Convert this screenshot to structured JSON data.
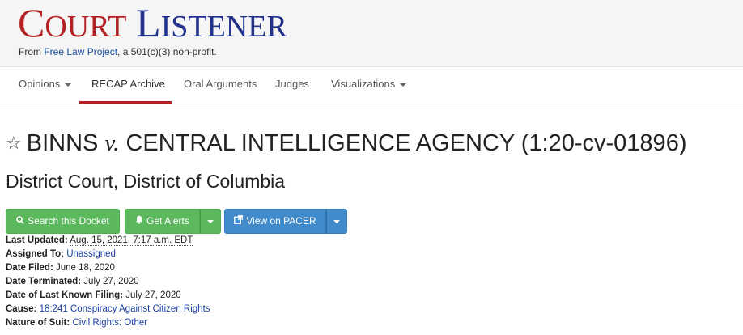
{
  "logo": {
    "court_c": "C",
    "court_rest": "OURT",
    "listener_l": "L",
    "listener_rest": "ISTENER"
  },
  "tagline": {
    "prefix": "From ",
    "link": "Free Law Project",
    "suffix": ", a 501(c)(3) non-profit."
  },
  "nav": {
    "items": [
      {
        "label": "Opinions",
        "has_caret": true
      },
      {
        "label": "RECAP Archive",
        "active": true
      },
      {
        "label": "Oral Arguments"
      },
      {
        "label": "Judges"
      },
      {
        "label": "Visualizations",
        "has_caret": true
      }
    ]
  },
  "case": {
    "title_before": "BINNS ",
    "title_v": "v.",
    "title_after": " CENTRAL INTELLIGENCE AGENCY (1:20-cv-01896)",
    "court": "District Court, District of Columbia"
  },
  "buttons": {
    "search": "Search this Docket",
    "alerts": "Get Alerts",
    "pacer": "View on PACER"
  },
  "meta": {
    "last_updated_label": "Last Updated:",
    "last_updated": "Aug. 15, 2021, 7:17 a.m. EDT",
    "assigned_label": "Assigned To:",
    "assigned": "Unassigned",
    "filed_label": "Date Filed:",
    "filed": "June 18, 2020",
    "terminated_label": "Date Terminated:",
    "terminated": "July 27, 2020",
    "last_filing_label": "Date of Last Known Filing:",
    "last_filing": "July 27, 2020",
    "cause_label": "Cause:",
    "cause": "18:241 Conspiracy Against Citizen Rights",
    "nos_label": "Nature of Suit:",
    "nos": "Civil Rights: Other"
  },
  "colors": {
    "brand_red": "#b32125",
    "brand_blue": "#22328c",
    "success": "#5cb85c",
    "primary": "#428bca"
  },
  "icons": {
    "favorite": "star-outline-icon",
    "search": "search-icon",
    "alerts": "bell-icon",
    "pacer": "external-link-icon"
  }
}
